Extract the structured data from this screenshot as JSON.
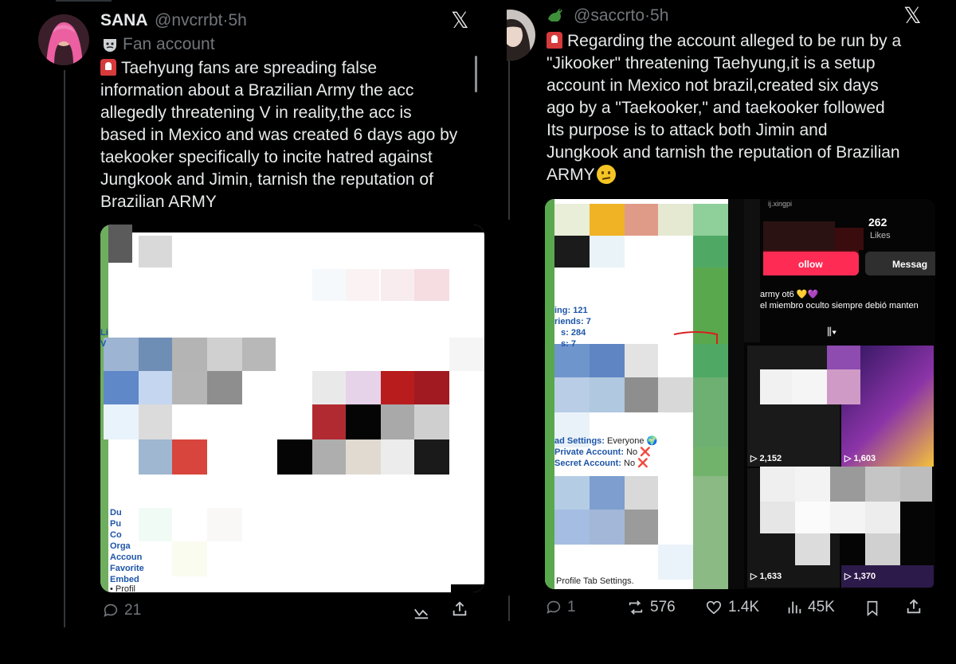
{
  "left_post": {
    "name": "SANA",
    "handle": "@nvcrrbt",
    "time": "5h",
    "badge_label": "Fan account",
    "text_lines": [
      "Taehyung fans are spreading false",
      "information about a Brazilian Army the acc",
      "allegedly threatening V in reality,the acc is",
      "based in Mexico and was created 6 days ago by",
      "taekooker specifically to incite hatred against",
      "Jungkook and Jimin, tarnish the reputation of",
      "Brazilian ARMY"
    ],
    "media_text": [
      "Li",
      "V",
      "Du",
      "Pu",
      "Co",
      "Orga",
      "Accoun",
      "Favorite",
      "Embed",
      "• Profil"
    ],
    "reply_count": "21"
  },
  "right_post": {
    "handle": "@saccrto",
    "time": "5h",
    "text_lines": [
      "Regarding the account alleged to be run by a",
      "\"Jikooker\" threatening Taehyung,it is a setup",
      "account in Mexico not brazil,created six days",
      "ago by a \"Taekooker,\" and taekooker followed",
      "Its purpose is to attack both Jimin and",
      "Jungkook and tarnish the reputation of Brazilian",
      "ARMY"
    ],
    "media": {
      "stats": [
        "ing: 121",
        "riends: 7",
        "s: 284",
        "s: 7"
      ],
      "settings": [
        {
          "label": "ad Settings:",
          "value": "Everyone 🌍"
        },
        {
          "label": "Private Account:",
          "value": "No ❌"
        },
        {
          "label": "Secret Account:",
          "value": "No ❌"
        }
      ],
      "profile_tab": "Profile Tab Settings.",
      "likes_count": "262",
      "likes_label": "Likes",
      "follow_label": "ollow",
      "message_label": "Messag",
      "bio_line1": "army ot6 💛💜",
      "bio_line2": "el miembro oculto siempre debió manten",
      "top_snippet": "ij.xingpi",
      "view_counts": [
        "2,152",
        "1,603",
        "1,633",
        "1,370"
      ]
    },
    "actions": {
      "replies": "1",
      "reposts": "576",
      "likes": "1.4K",
      "views": "45K"
    }
  },
  "colors": {
    "background": "#000000",
    "text": "#e7e9ea",
    "muted": "#71767b",
    "siren": "#d63a3a"
  }
}
